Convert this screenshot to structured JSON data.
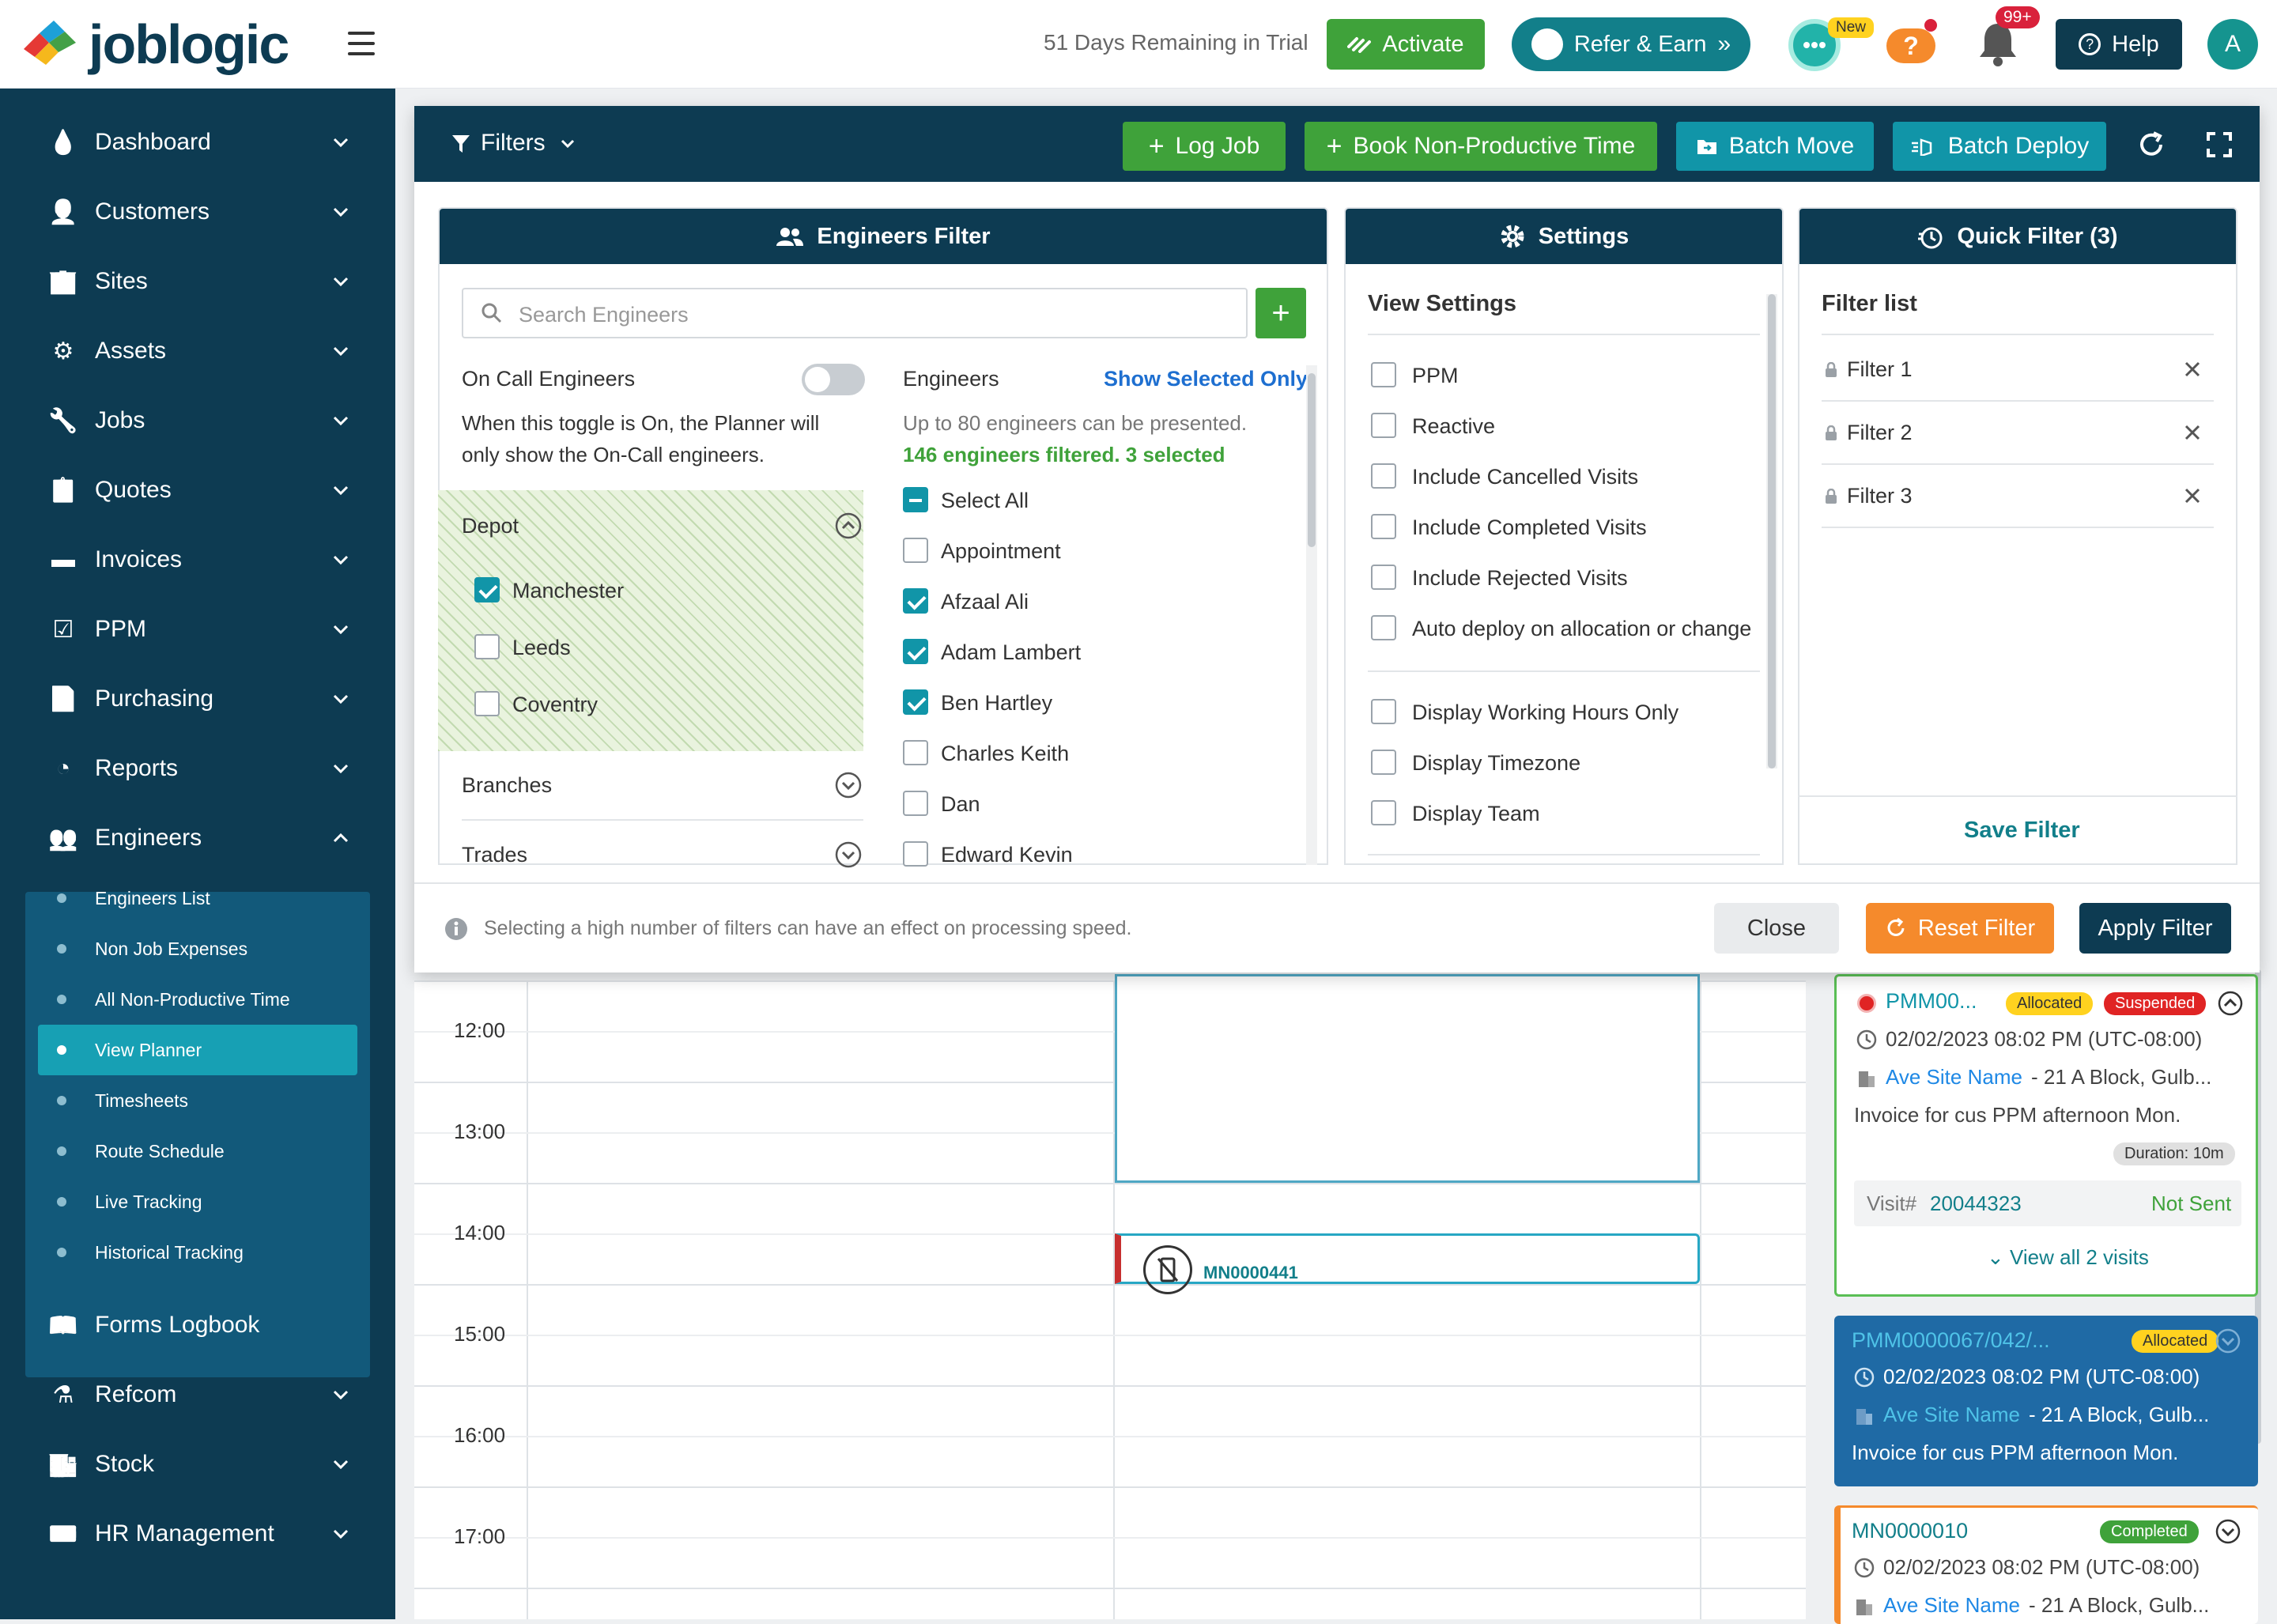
{
  "header": {
    "logo_text": "joblogic",
    "trial_text": "51 Days Remaining in Trial",
    "activate_label": "Activate",
    "refer_label": "Refer & Earn",
    "new_badge": "New",
    "notifications_badge": "99+",
    "help_label": "Help",
    "avatar_initial": "A"
  },
  "sidebar": {
    "items": [
      {
        "label": "Dashboard",
        "icon": "drop-icon"
      },
      {
        "label": "Customers",
        "icon": "person-icon"
      },
      {
        "label": "Sites",
        "icon": "building-icon"
      },
      {
        "label": "Assets",
        "icon": "asset-icon"
      },
      {
        "label": "Jobs",
        "icon": "wrench-icon"
      },
      {
        "label": "Quotes",
        "icon": "clipboard-icon"
      },
      {
        "label": "Invoices",
        "icon": "card-icon"
      },
      {
        "label": "PPM",
        "icon": "calendar-check-icon"
      },
      {
        "label": "Purchasing",
        "icon": "document-icon"
      },
      {
        "label": "Reports",
        "icon": "pie-icon"
      },
      {
        "label": "Engineers",
        "icon": "people-icon"
      },
      {
        "label": "Forms Logbook",
        "icon": "book-icon"
      },
      {
        "label": "Refcom",
        "icon": "canister-icon"
      },
      {
        "label": "Stock",
        "icon": "warehouse-icon"
      },
      {
        "label": "HR Management",
        "icon": "id-icon"
      }
    ],
    "engineers_sub": [
      "Engineers List",
      "Non Job Expenses",
      "All Non-Productive Time",
      "View Planner",
      "Timesheets",
      "Route Schedule",
      "Live Tracking",
      "Historical Tracking"
    ]
  },
  "toolbar": {
    "filters_label": "Filters",
    "log_job": "Log Job",
    "book_npt": "Book Non-Productive Time",
    "batch_move": "Batch Move",
    "batch_deploy": "Batch Deploy"
  },
  "engineers_filter": {
    "title": "Engineers Filter",
    "search_placeholder": "Search Engineers",
    "on_call_label": "On Call Engineers",
    "on_call_desc_1": "When this toggle is On, the Planner will",
    "on_call_desc_2": "only show the On-Call engineers.",
    "depot_label": "Depot",
    "depots": [
      {
        "name": "Manchester",
        "checked": true
      },
      {
        "name": "Leeds",
        "checked": false
      },
      {
        "name": "Coventry",
        "checked": false
      }
    ],
    "branches_label": "Branches",
    "trades_label": "Trades",
    "engineers_label": "Engineers",
    "show_selected": "Show Selected Only",
    "limit_note": "Up to 80 engineers can be presented.",
    "filtered_note": "146 engineers filtered. 3 selected",
    "engineers": [
      {
        "name": "Select All",
        "state": "indeterminate"
      },
      {
        "name": "Appointment",
        "state": "off"
      },
      {
        "name": "Afzaal Ali",
        "state": "on"
      },
      {
        "name": "Adam Lambert",
        "state": "on"
      },
      {
        "name": "Ben Hartley",
        "state": "on"
      },
      {
        "name": "Charles Keith",
        "state": "off"
      },
      {
        "name": "Dan",
        "state": "off"
      },
      {
        "name": "Edward Kevin",
        "state": "off"
      }
    ]
  },
  "settings": {
    "title": "Settings",
    "view_settings": "View Settings",
    "options": [
      "PPM",
      "Reactive",
      "Include Cancelled Visits",
      "Include Completed Visits",
      "Include Rejected Visits",
      "Auto deploy on allocation or change"
    ],
    "options2": [
      "Display Working Hours Only",
      "Display Timezone",
      "Display Team"
    ]
  },
  "quick_filter": {
    "title": "Quick Filter (3)",
    "filter_list": "Filter list",
    "filters": [
      "Filter 1",
      "Filter 2",
      "Filter 3"
    ],
    "save_filter": "Save Filter"
  },
  "footer": {
    "note": "Selecting a high number of filters can have an effect on processing speed.",
    "close": "Close",
    "reset": "Reset Filter",
    "apply": "Apply Filter"
  },
  "planner": {
    "times": [
      "12:00",
      "13:00",
      "14:00",
      "15:00",
      "16:00",
      "17:00"
    ],
    "job_ref": "MN0000441"
  },
  "cards": [
    {
      "ref": "PMM00...",
      "badges": [
        "Allocated",
        "Suspended"
      ],
      "datetime": "02/02/2023 08:02 PM (UTC-08:00)",
      "site": "Ave Site Name",
      "address": "- 21 A Block, Gulb...",
      "desc": "Invoice for cus PPM afternoon Mon.",
      "duration": "Duration: 10m",
      "visit_label": "Visit#",
      "visit_no": "20044323",
      "visit_status": "Not Sent",
      "view_all": "View all 2 visits"
    },
    {
      "ref": "PMM0000067/042/...",
      "badges": [
        "Allocated"
      ],
      "datetime": "02/02/2023 08:02 PM (UTC-08:00)",
      "site": "Ave Site Name",
      "address": "- 21 A Block, Gulb...",
      "desc": "Invoice for cus PPM afternoon Mon."
    },
    {
      "ref": "MN0000010",
      "badges": [
        "Completed"
      ],
      "datetime": "02/02/2023 08:02 PM (UTC-08:00)",
      "site": "Ave Site Name",
      "address": "- 21 A Block, Gulb..."
    }
  ],
  "colors": {
    "navy": "#0d3b52",
    "green": "#3fa23a",
    "teal": "#1195a8",
    "orange": "#f58a2c",
    "red": "#d9213b"
  }
}
